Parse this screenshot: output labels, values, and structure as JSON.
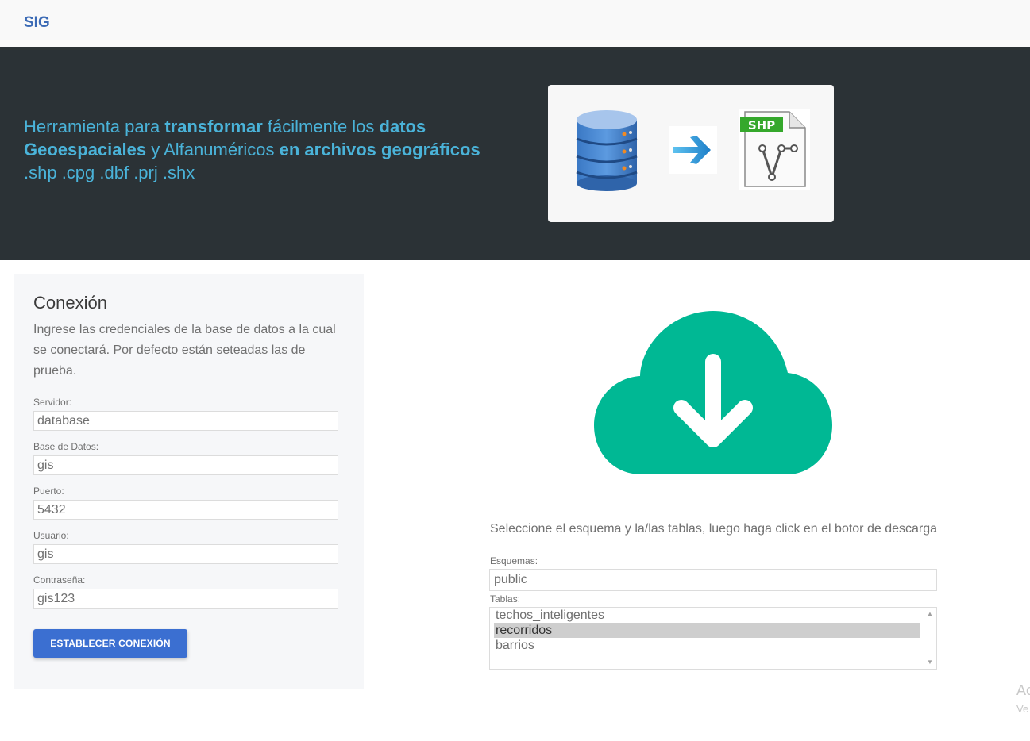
{
  "navbar": {
    "brand": "SIG"
  },
  "hero": {
    "text_parts": [
      "Herramienta para ",
      "transformar",
      " fácilmente los ",
      "datos",
      "Geoespaciales",
      " y Alfanuméricos ",
      "en archivos geográficos",
      ".shp .cpg .dbf .prj .shx"
    ],
    "shp_badge": "SHP",
    "icons": [
      "database-icon",
      "arrow-right-icon",
      "shp-file-icon"
    ]
  },
  "connection": {
    "title": "Conexión",
    "description": "Ingrese las credenciales de la base de datos a la cual se conectará. Por defecto están seteadas las de prueba.",
    "fields": [
      {
        "label": "Servidor:",
        "value": "database"
      },
      {
        "label": "Base de Datos:",
        "value": "gis"
      },
      {
        "label": "Puerto:",
        "value": "5432"
      },
      {
        "label": "Usuario:",
        "value": "gis"
      },
      {
        "label": "Contraseña:",
        "value": "gis123"
      }
    ],
    "button_label": "ESTABLECER CONEXIÓN"
  },
  "download": {
    "icon": "cloud-download-icon",
    "hint": "Seleccione el esquema y la/las tablas, luego haga click en el botor de descarga",
    "schemas_label": "Esquemas:",
    "schema_value": "public",
    "tables_label": "Tablas:",
    "tables": [
      "techos_inteligentes",
      "recorridos",
      "barrios"
    ],
    "selected_table": "recorridos"
  },
  "watermark": {
    "line1": "Activar Windows",
    "line2": "Ve a Configuración para activar Windows."
  },
  "colors": {
    "brand": "#3b6ab5",
    "hero_bg": "#2b3236",
    "hero_text": "#4ab3d9",
    "button": "#3b6fd1",
    "cloud": "#00b894"
  }
}
